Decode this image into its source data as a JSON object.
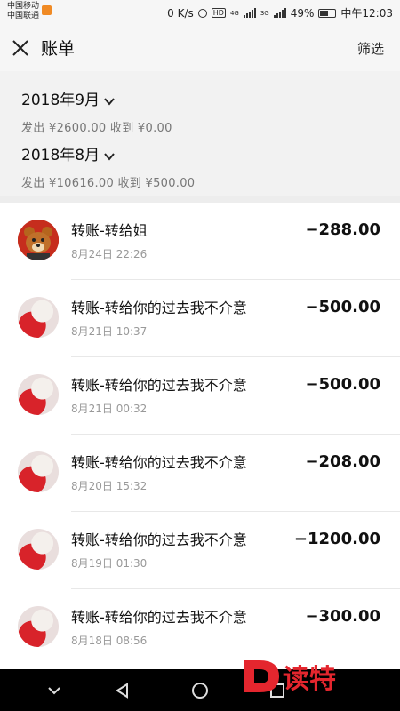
{
  "status": {
    "carrier1": "中国移动",
    "carrier2": "中国联通",
    "speed": "0 K/s",
    "battery": "49%",
    "time": "中午12:03",
    "net1": "4G",
    "net2": "3G",
    "hd": "HD"
  },
  "header": {
    "title": "账单",
    "filter_label": "筛选"
  },
  "summary": [
    {
      "month": "2018年9月",
      "stats": "发出 ¥2600.00 收到 ¥0.00"
    },
    {
      "month": "2018年8月",
      "stats": "发出 ¥10616.00 收到 ¥500.00"
    }
  ],
  "transactions": [
    {
      "title": "转账-转给姐",
      "time": "8月24日 22:26",
      "amount": "−288.00",
      "avatar": "bear-avatar"
    },
    {
      "title": "转账-转给你的过去我不介意",
      "time": "8月21日 10:37",
      "amount": "−500.00",
      "avatar": "photo-avatar"
    },
    {
      "title": "转账-转给你的过去我不介意",
      "time": "8月21日 00:32",
      "amount": "−500.00",
      "avatar": "photo-avatar"
    },
    {
      "title": "转账-转给你的过去我不介意",
      "time": "8月20日 15:32",
      "amount": "−208.00",
      "avatar": "photo-avatar"
    },
    {
      "title": "转账-转给你的过去我不介意",
      "time": "8月19日 01:30",
      "amount": "−1200.00",
      "avatar": "photo-avatar"
    },
    {
      "title": "转账-转给你的过去我不介意",
      "time": "8月18日 08:56",
      "amount": "−300.00",
      "avatar": "photo-avatar"
    }
  ],
  "watermark": {
    "text": "读特",
    "logo_letter": "D",
    "color": "#e4262e"
  },
  "nav": [
    "back-icon",
    "home-icon",
    "recents-icon",
    "hide-icon"
  ]
}
